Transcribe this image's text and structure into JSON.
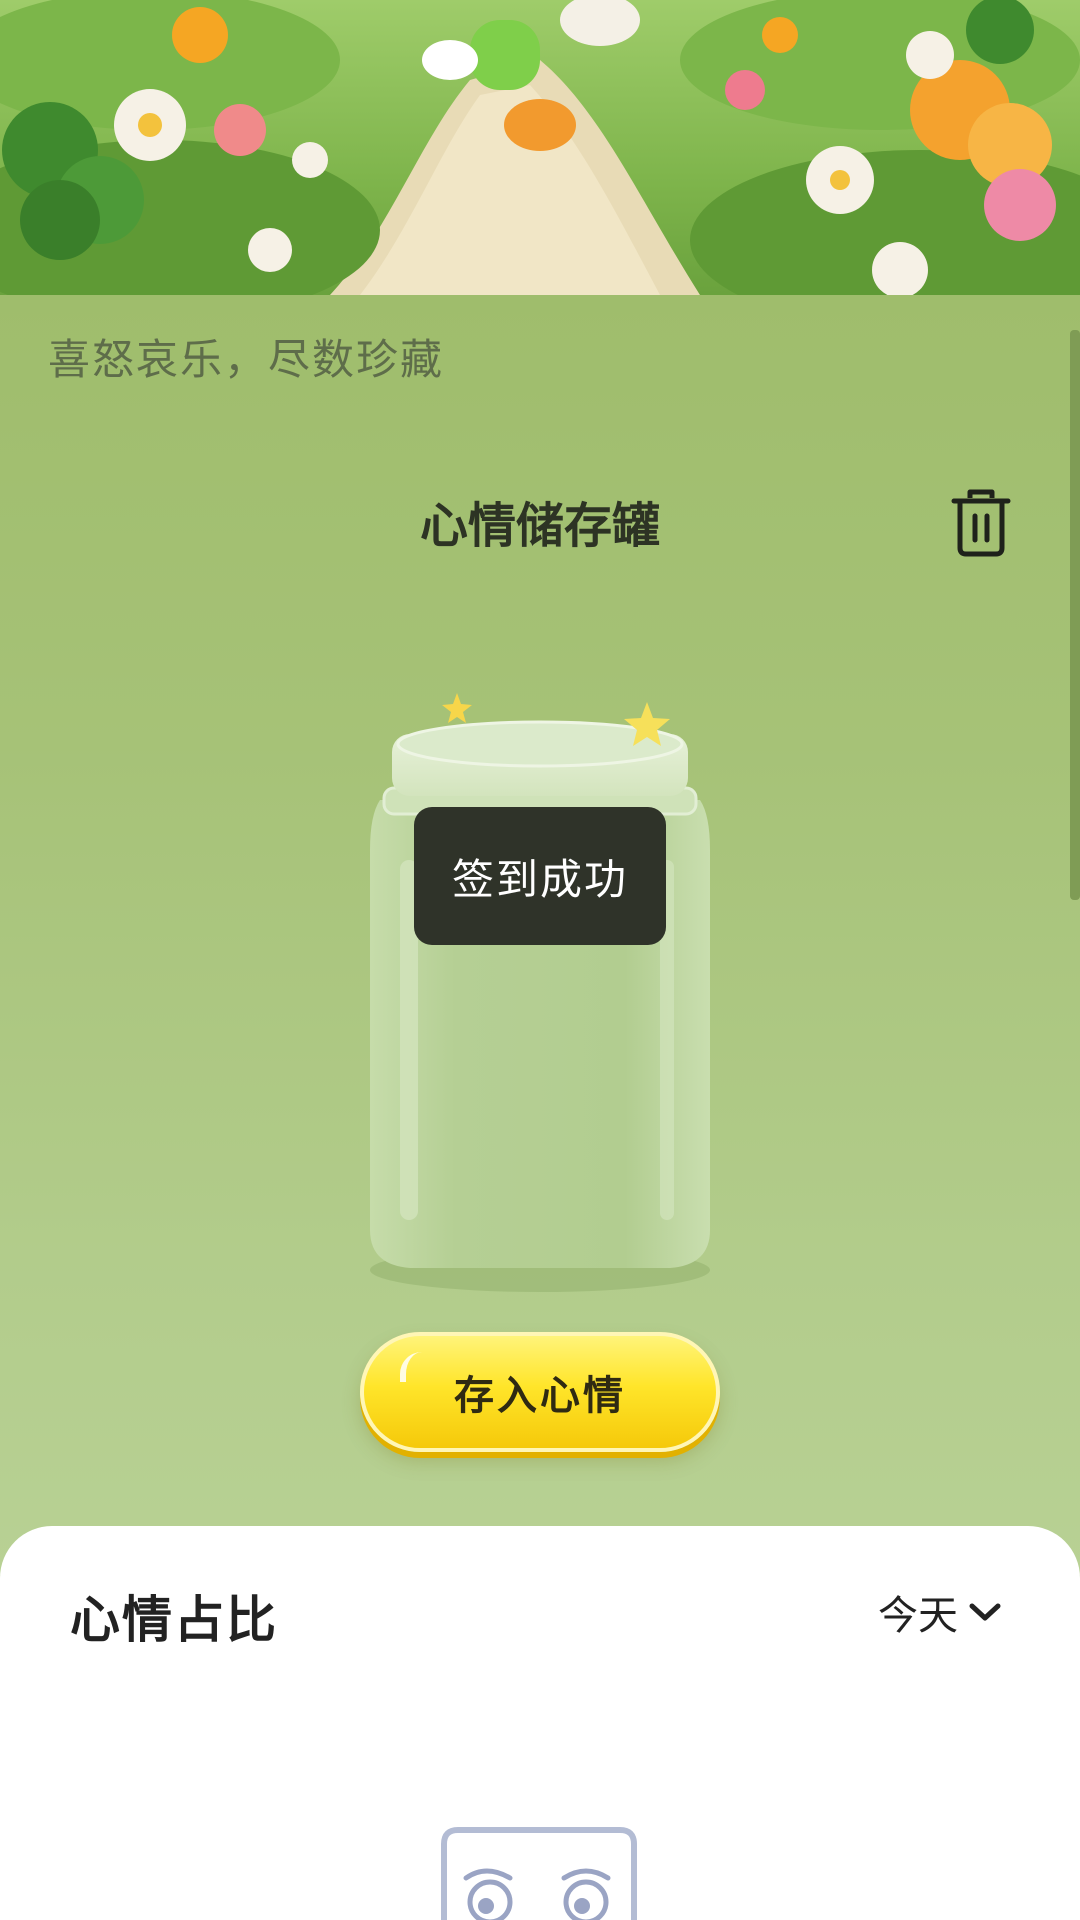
{
  "header": {
    "tagline": "喜怒哀乐，尽数珍藏",
    "title": "心情储存罐"
  },
  "icons": {
    "trash": "trash-icon",
    "chevron": "chevron-down-icon",
    "star": "star-icon"
  },
  "jar": {
    "toast": "签到成功"
  },
  "actions": {
    "deposit_label": "存入心情"
  },
  "mood_ratio": {
    "title": "心情占比",
    "period": "今天"
  },
  "colors": {
    "panel_green": "#a6c277",
    "button_yellow": "#ffe52a",
    "toast_bg": "#2f3329",
    "text_dark": "#2d3324"
  }
}
